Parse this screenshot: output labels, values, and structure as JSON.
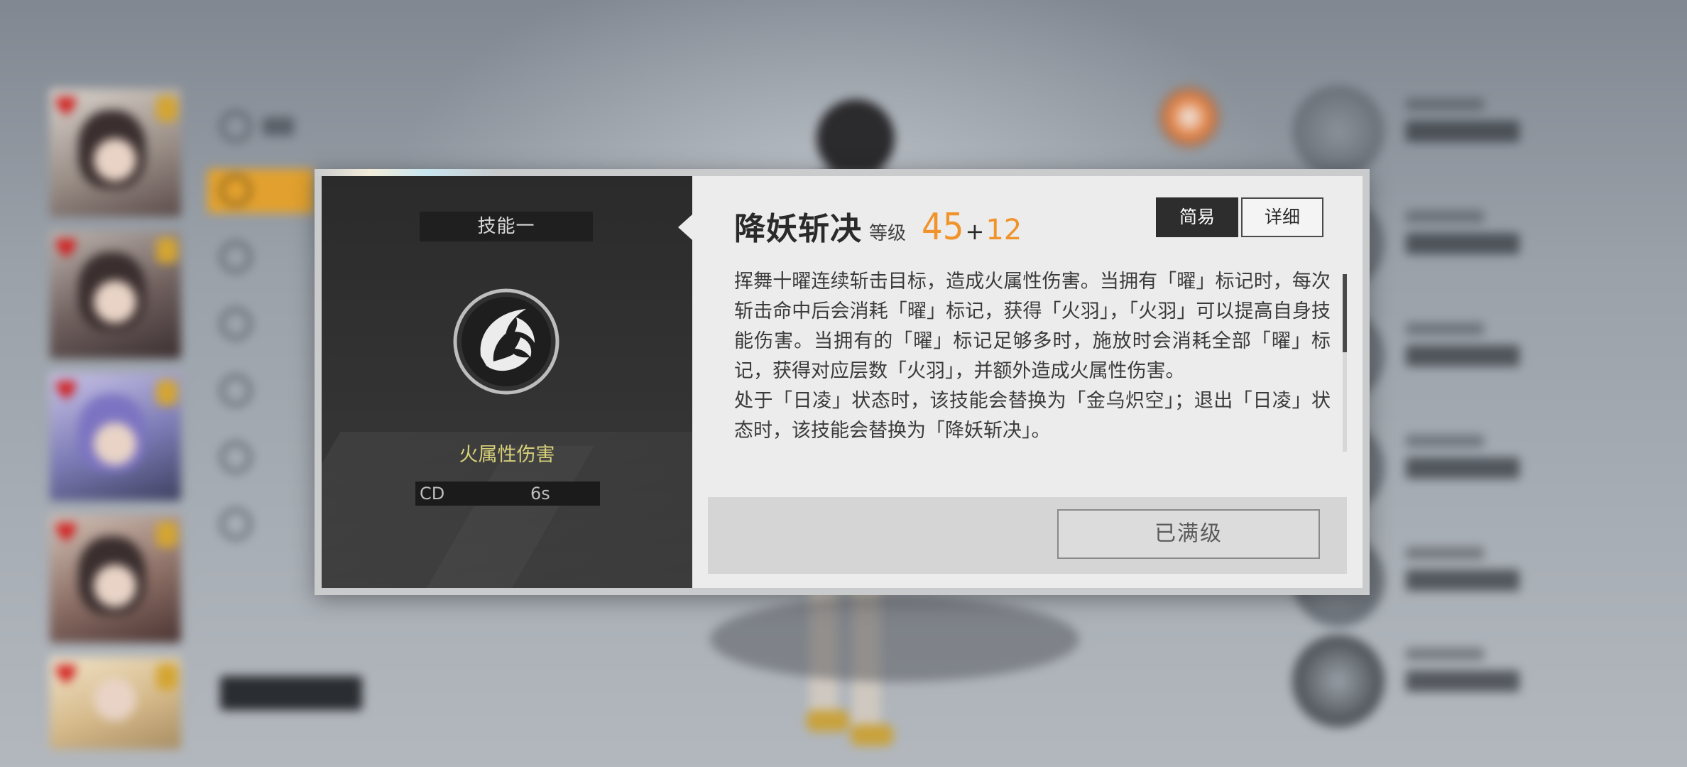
{
  "dialog": {
    "skill_slot": "技能一",
    "icon": "fire-feather-skill-icon",
    "element": "火属性伤害",
    "cd_label": "CD",
    "cd_value": "6s",
    "skill_name": "降妖斩决",
    "level_label": "等级",
    "level_value": "45",
    "level_plus": "+",
    "level_bonus": "12",
    "mode_simple": "简易",
    "mode_detail": "详细",
    "description": "挥舞十曜连续斩击目标，造成火属性伤害。当拥有「曜」标记时，每次斩击命中后会消耗「曜」标记，获得「火羽」，「火羽」可以提高自身技能伤害。当拥有的「曜」标记足够多时，施放时会消耗全部「曜」标记，获得对应层数「火羽」，并额外造成火属性伤害。\n处于「日凌」状态时，该技能会替换为「金乌炽空」；退出「日凌」状态时，该技能会替换为「降妖斩决」。",
    "maxed_label": "已满级"
  },
  "colors": {
    "accent_orange": "#f0932b",
    "element_yellow": "#d6cf7a",
    "dark_panel": "#2b2b2b",
    "light_panel": "#ececec"
  }
}
